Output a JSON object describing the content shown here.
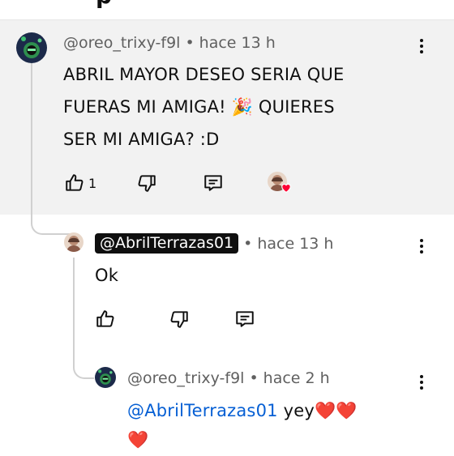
{
  "comments": [
    {
      "author": "@oreo_trixy-f9l",
      "separator": "•",
      "time": "hace 13 h",
      "text_lines": [
        "ABRIL MAYOR DESEO SERIA QUE",
        "FUERAS MI AMIGA! 🎉 QUIERES",
        "SER MI AMIGA? :D"
      ],
      "like_count": "1"
    },
    {
      "author": "@AbrilTerrazas01",
      "separator": "•",
      "time": "hace 13 h",
      "text": "Ok"
    },
    {
      "author": "@oreo_trixy-f9l",
      "separator": "•",
      "time": "hace 2 h",
      "mention": "@AbrilTerrazas01",
      "text_after": " yey❤️❤️",
      "text_line2": "❤️"
    }
  ],
  "icons": {
    "like": "thumb-up-icon",
    "dislike": "thumb-down-icon",
    "reply": "reply-comment-icon",
    "more": "more-vertical-icon",
    "creator_heart": "heart-icon"
  },
  "colors": {
    "highlight_background": "#f2f2f2",
    "author_chip": "#0f0f0f",
    "mention": "#065fd4",
    "heart": "#ff0033"
  }
}
